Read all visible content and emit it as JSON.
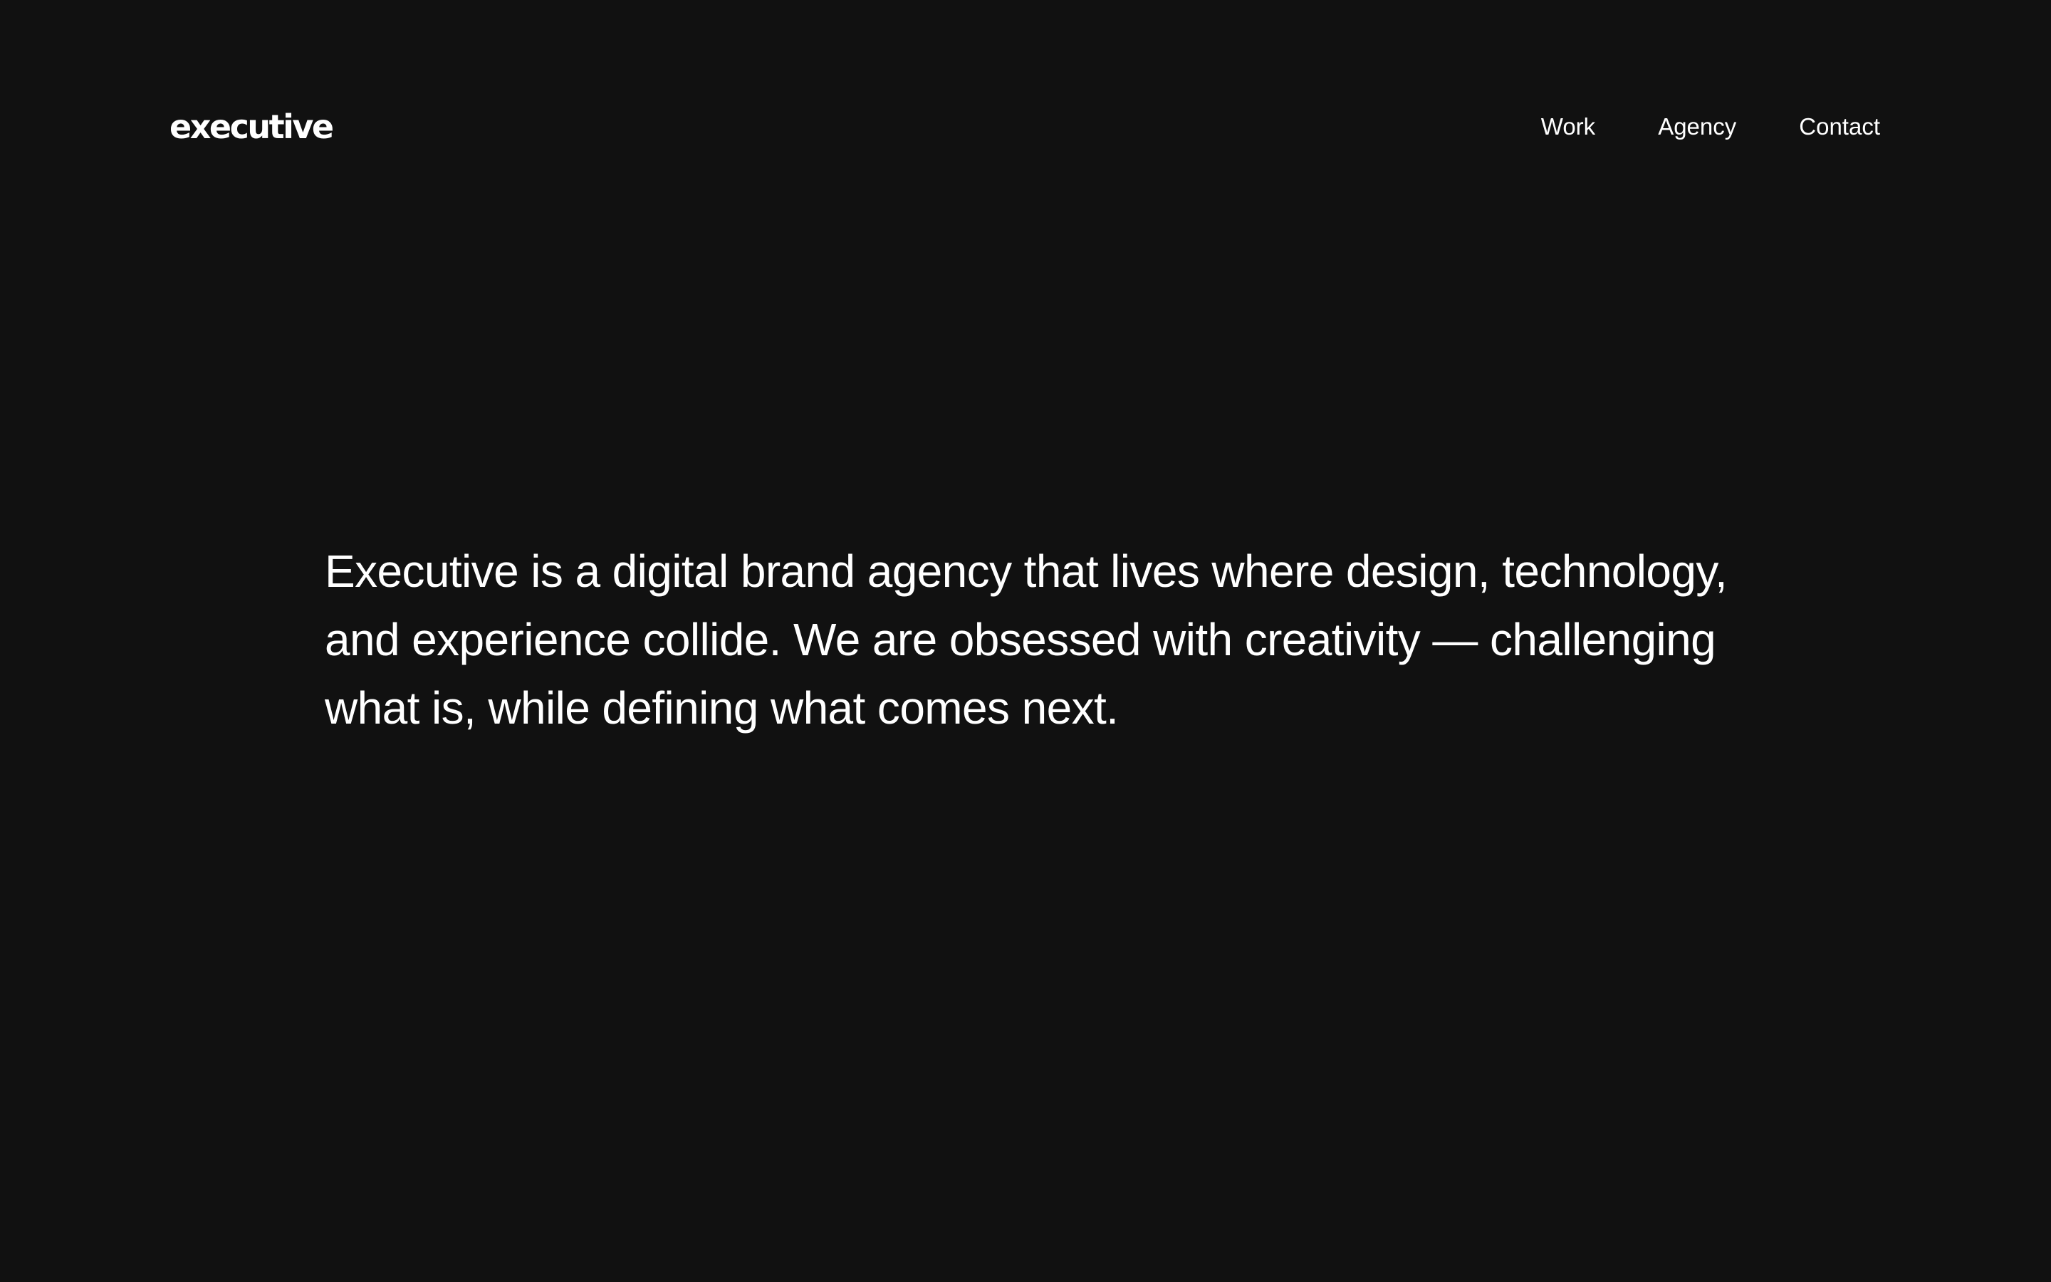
{
  "header": {
    "logo_text": "executive",
    "nav": [
      {
        "label": "Work"
      },
      {
        "label": "Agency"
      },
      {
        "label": "Contact"
      }
    ]
  },
  "hero": {
    "statement": "Executive is a digital brand agency that lives where design, technology, and experience collide. We are obsessed with creativity — challenging what is, while defining what comes next."
  },
  "colors": {
    "background": "#111111",
    "text": "#ffffff"
  }
}
